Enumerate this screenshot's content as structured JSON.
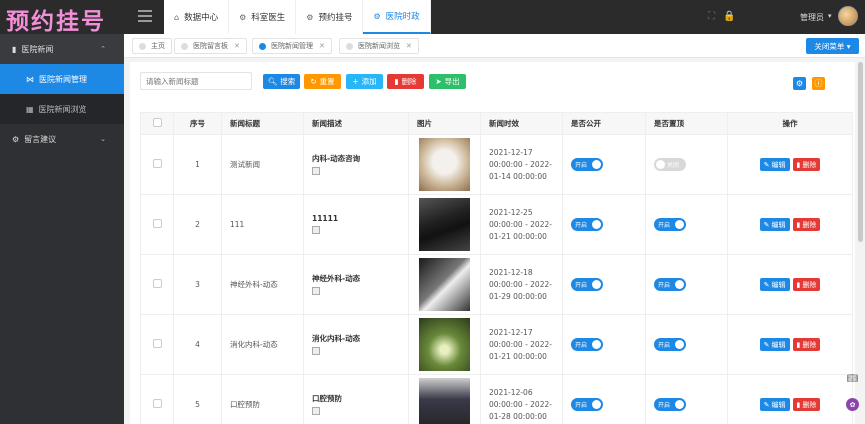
{
  "app": {
    "logo": "预约挂号"
  },
  "top_tabs": [
    {
      "icon": "home-icon",
      "glyph": "⌂",
      "label": "数据中心"
    },
    {
      "icon": "gear-icon",
      "glyph": "⚙",
      "label": "科室医生"
    },
    {
      "icon": "gear-icon",
      "glyph": "⚙",
      "label": "预约挂号"
    },
    {
      "icon": "gear-icon",
      "glyph": "⚙",
      "label": "医院时政",
      "active": true
    }
  ],
  "user": {
    "label": "管理员"
  },
  "sidebar": {
    "group1": {
      "label": "医院新闻",
      "items": [
        {
          "label": "医院新闻管理",
          "active": true
        },
        {
          "label": "医院新闻浏览"
        }
      ]
    },
    "group2": {
      "label": "留言建议"
    }
  },
  "breadcrumb_tabs": [
    {
      "label": "主页"
    },
    {
      "label": "医院留言板"
    },
    {
      "label": "医院新闻管理",
      "active": true
    },
    {
      "label": "医院新闻浏览"
    }
  ],
  "close_menu": "关闭菜单",
  "toolbar": {
    "search_placeholder": "请输入新闻标题",
    "search": "搜索",
    "reset": "重置",
    "add": "添加",
    "delete": "删除",
    "export": "导出"
  },
  "table": {
    "headers": [
      "序号",
      "新闻标题",
      "新闻描述",
      "图片",
      "新闻时效",
      "是否公开",
      "是否置顶",
      "操作"
    ],
    "switch_on": "开启",
    "switch_off": "关闭",
    "edit": "编辑",
    "delete": "删除",
    "rows": [
      {
        "no": "1",
        "title": "测试新闻",
        "desc": "内科-动态咨询",
        "time": "2021-12-17 00:00:00 - 2022-01-14 00:00:00",
        "public": true,
        "top": false
      },
      {
        "no": "2",
        "title": "111",
        "desc": "11111",
        "time": "2021-12-25 00:00:00 - 2022-01-21 00:00:00",
        "public": true,
        "top": true
      },
      {
        "no": "3",
        "title": "神经外科-动态",
        "desc": "神经外科-动态",
        "time": "2021-12-18 00:00:00 - 2022-01-29 00:00:00",
        "public": true,
        "top": true
      },
      {
        "no": "4",
        "title": "消化内科-动态",
        "desc": "消化内科-动态",
        "time": "2021-12-17 00:00:00 - 2022-01-21 00:00:00",
        "public": true,
        "top": true
      },
      {
        "no": "5",
        "title": "口腔预防",
        "desc": "口腔预防",
        "time": "2021-12-06 00:00:00 - 2022-01-28 00:00:00",
        "public": true,
        "top": true
      }
    ]
  },
  "colors": {
    "primary": "#1e88e5",
    "danger": "#e53935",
    "warning": "#ff9800",
    "info": "#29b6f6",
    "success": "#2ebf6b",
    "logo": "#f28fd8"
  }
}
